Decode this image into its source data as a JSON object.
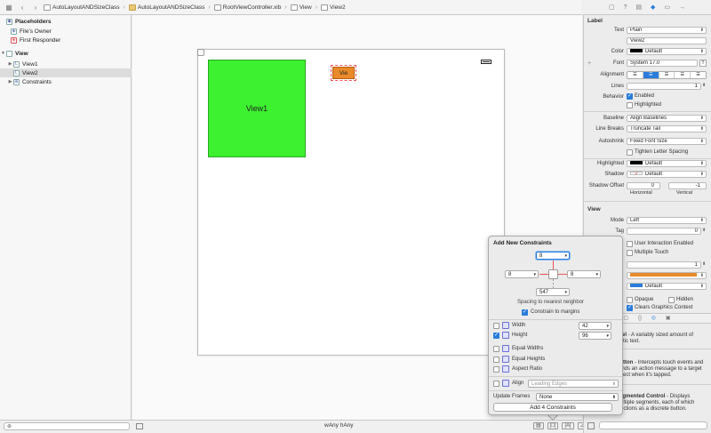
{
  "jumpbar": {
    "crumbs": [
      "AutoLayoutANDSizeClass",
      "AutoLayoutANDSizeClass",
      "RootViewController.xib",
      "View",
      "View2"
    ]
  },
  "outline": {
    "placeholders": "Placeholders",
    "files_owner": "File's Owner",
    "first_responder": "First Responder",
    "view": "View",
    "view1": "View1",
    "view2": "View2",
    "constraints": "Constraints"
  },
  "canvas": {
    "view1_label": "View1",
    "view2_label": "Vie",
    "size_class": "wAny hAny"
  },
  "inspector": {
    "label_section": "Label",
    "text_label": "Text",
    "text_value": "Plain",
    "text_content": "View2",
    "color_label": "Color",
    "color_value": "Default",
    "font_label": "Font",
    "font_value": "System 17.0",
    "alignment_label": "Alignment",
    "lines_label": "Lines",
    "lines_value": "1",
    "behavior_label": "Behavior",
    "enabled": "Enabled",
    "highlighted": "Highlighted",
    "baseline_label": "Baseline",
    "baseline_value": "Align Baselines",
    "linebreaks_label": "Line Breaks",
    "linebreaks_value": "Truncate Tail",
    "autoshrink_label": "Autoshrink",
    "autoshrink_value": "Fixed Font Size",
    "tighten": "Tighten Letter Spacing",
    "highlighted_label": "Highlighted",
    "highlighted_value": "Default",
    "shadow_label": "Shadow",
    "shadow_value": "Default",
    "shadow_offset_label": "Shadow Offset",
    "shadow_h": "0",
    "shadow_v": "-1",
    "horizontal": "Horizontal",
    "vertical": "Vertical",
    "view_section": "View",
    "mode_label": "Mode",
    "mode_value": "Left",
    "tag_label": "Tag",
    "tag_value": "0",
    "interaction_partial": "ion",
    "user_interaction": "User Interaction Enabled",
    "multiple_touch": "Multiple Touch",
    "alpha_partial": "ha",
    "alpha_value": "1",
    "background_partial": "nd",
    "tint_partial": "int",
    "tint_value": "Default",
    "drawing_partial": "ng",
    "opaque": "Opaque",
    "hidden": "Hidden",
    "clears": "Clears Graphics Context",
    "accent_orange": "#e98a2a",
    "accent_blue": "#2a7cda"
  },
  "library": [
    {
      "title": "abel",
      "desc": " - A variably sized amount of",
      "desc2": "static text."
    },
    {
      "title": "Button",
      "desc": " - Intercepts touch events and",
      "desc2": "sends an action message to a target",
      "desc3": "object when it's tapped."
    },
    {
      "title": "Segmented Control",
      "desc": " - Displays",
      "desc2": "multiple segments, each of which",
      "desc3": "functions as a discrete button."
    }
  ],
  "popover": {
    "title": "Add New Constraints",
    "top": "8",
    "left": "8",
    "right": "8",
    "bottom": "547",
    "spacing_note": "Spacing to nearest neighbor",
    "constrain_margins": "Constrain to margins",
    "width_label": "Width",
    "width_value": "42",
    "height_label": "Height",
    "height_value": "96",
    "equal_widths": "Equal Widths",
    "equal_heights": "Equal Heights",
    "aspect_ratio": "Aspect Ratio",
    "align_label": "Align",
    "align_value": "Leading Edges",
    "update_frames_label": "Update Frames",
    "update_frames_value": "None",
    "add_button": "Add 4 Constraints"
  }
}
